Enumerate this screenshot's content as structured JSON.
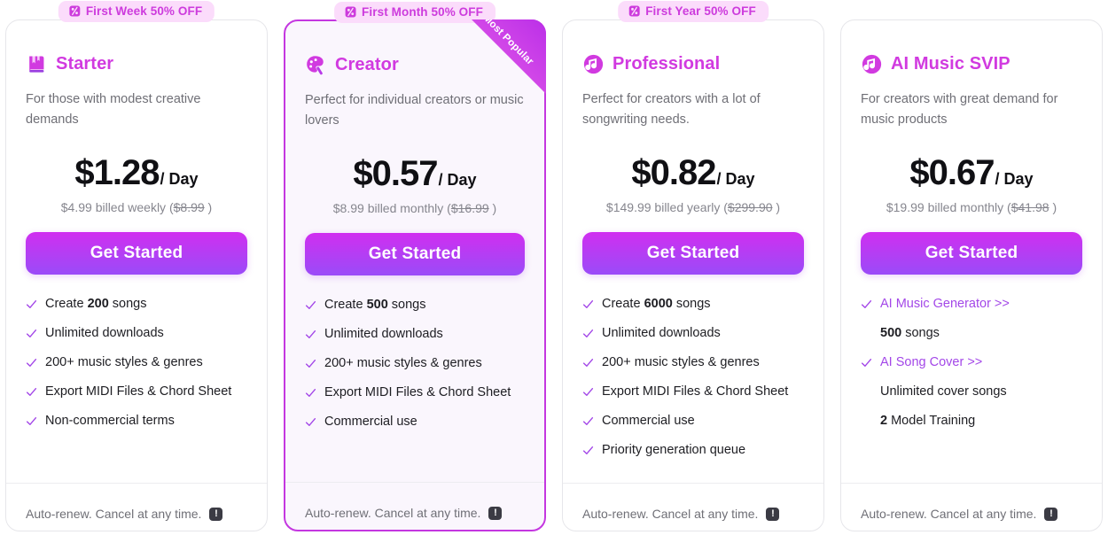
{
  "theme": {
    "accent": "#d13ae0",
    "accent_purple": "#a347e8",
    "badge_bg": "#fbdcfb",
    "badge_text": "#cd3bdd",
    "featured_bg": "#faf6fd",
    "featured_border": "#c437e0",
    "cta_gradient_from": "#d02ef0",
    "cta_gradient_to": "#9a4bf8",
    "check_color": "#a347e8",
    "price_color": "#101014",
    "muted_text": "#86868e"
  },
  "common": {
    "cta_label": "Get Started",
    "footer_note": "Auto-renew. Cancel at any time.",
    "footer_icon": "!",
    "footer_icon_name": "info-exclamation-icon",
    "badge_icon_name": "discount-percent-icon",
    "check_icon_name": "check-icon",
    "price_unit": "/ Day"
  },
  "plans": [
    {
      "id": "starter",
      "badge": "First Week 50% OFF",
      "icon_name": "book-icon",
      "name": "Starter",
      "description": "For those with modest creative demands",
      "price": "$1.28",
      "price_unit": "/ Day",
      "billing_prefix": "$4.99 billed weekly (",
      "billing_old": "$8.99",
      "billing_suffix": " )",
      "featured": false,
      "ribbon": "",
      "features": [
        {
          "type": "check",
          "pre": "Create ",
          "bold": "200",
          "post": " songs"
        },
        {
          "type": "check",
          "pre": "Unlimited downloads",
          "bold": "",
          "post": ""
        },
        {
          "type": "check",
          "pre": "200+ music styles & genres",
          "bold": "",
          "post": ""
        },
        {
          "type": "check",
          "pre": "Export MIDI Files & Chord Sheet",
          "bold": "",
          "post": ""
        },
        {
          "type": "check",
          "pre": "Non-commercial terms",
          "bold": "",
          "post": ""
        }
      ]
    },
    {
      "id": "creator",
      "badge": "First Month 50% OFF",
      "icon_name": "palette-icon",
      "name": "Creator",
      "description": "Perfect for individual creators or music lovers",
      "price": "$0.57",
      "price_unit": "/ Day",
      "billing_prefix": "$8.99 billed monthly (",
      "billing_old": "$16.99",
      "billing_suffix": " )",
      "featured": true,
      "ribbon": "Most Popular",
      "features": [
        {
          "type": "check",
          "pre": "Create ",
          "bold": "500",
          "post": " songs"
        },
        {
          "type": "check",
          "pre": "Unlimited downloads",
          "bold": "",
          "post": ""
        },
        {
          "type": "check",
          "pre": "200+ music styles & genres",
          "bold": "",
          "post": ""
        },
        {
          "type": "check",
          "pre": "Export MIDI Files & Chord Sheet",
          "bold": "",
          "post": ""
        },
        {
          "type": "check",
          "pre": "Commercial use",
          "bold": "",
          "post": ""
        }
      ]
    },
    {
      "id": "professional",
      "badge": "First Year 50% OFF",
      "icon_name": "music-note-circle-icon",
      "name": "Professional",
      "description": "Perfect for creators with a lot of songwriting needs.",
      "price": "$0.82",
      "price_unit": "/ Day",
      "billing_prefix": "$149.99 billed yearly (",
      "billing_old": "$299.90",
      "billing_suffix": " )",
      "featured": false,
      "ribbon": "",
      "features": [
        {
          "type": "check",
          "pre": "Create ",
          "bold": "6000",
          "post": " songs"
        },
        {
          "type": "check",
          "pre": "Unlimited downloads",
          "bold": "",
          "post": ""
        },
        {
          "type": "check",
          "pre": "200+ music styles & genres",
          "bold": "",
          "post": ""
        },
        {
          "type": "check",
          "pre": "Export MIDI Files & Chord Sheet",
          "bold": "",
          "post": ""
        },
        {
          "type": "check",
          "pre": "Commercial use",
          "bold": "",
          "post": ""
        },
        {
          "type": "check",
          "pre": "Priority generation queue",
          "bold": "",
          "post": ""
        }
      ]
    },
    {
      "id": "ai-music-svip",
      "badge": "",
      "icon_name": "music-note-circle-icon",
      "name": "AI Music SVIP",
      "description": "For creators with great demand for music products",
      "price": "$0.67",
      "price_unit": "/ Day",
      "billing_prefix": "$19.99 billed monthly (",
      "billing_old": "$41.98",
      "billing_suffix": " )",
      "featured": false,
      "ribbon": "",
      "features": [
        {
          "type": "link",
          "pre": "AI Music Generator >>",
          "bold": "",
          "post": ""
        },
        {
          "type": "sub",
          "pre": "",
          "bold": "500",
          "post": " songs"
        },
        {
          "type": "link",
          "pre": "AI Song Cover >>",
          "bold": "",
          "post": ""
        },
        {
          "type": "sub",
          "pre": "Unlimited cover songs",
          "bold": "",
          "post": ""
        },
        {
          "type": "sub",
          "pre": "",
          "bold": "2",
          "post": " Model Training"
        }
      ]
    }
  ]
}
